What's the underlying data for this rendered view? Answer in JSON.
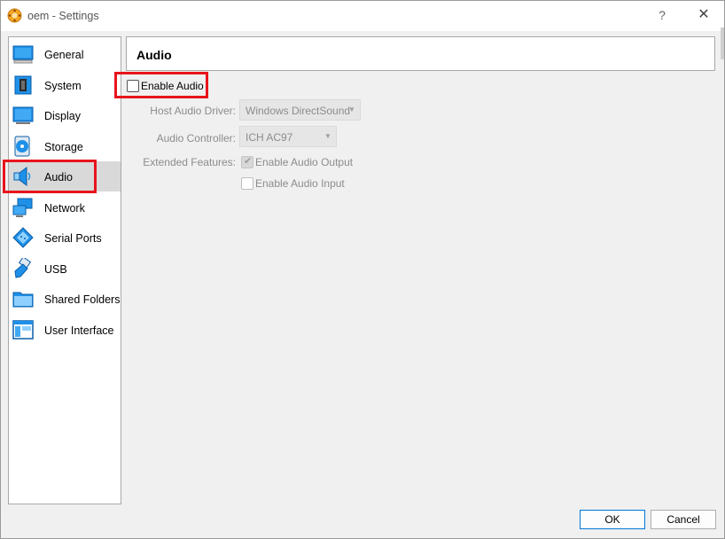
{
  "window": {
    "title": "oem - Settings",
    "help_glyph": "?",
    "close_glyph": "✕"
  },
  "sidebar": {
    "selected": "Audio",
    "items": [
      {
        "label": "General",
        "icon": "general-monitor-icon"
      },
      {
        "label": "System",
        "icon": "system-chip-icon"
      },
      {
        "label": "Display",
        "icon": "display-monitor-icon"
      },
      {
        "label": "Storage",
        "icon": "storage-disc-icon"
      },
      {
        "label": "Audio",
        "icon": "speaker-icon"
      },
      {
        "label": "Network",
        "icon": "network-icon"
      },
      {
        "label": "Serial Ports",
        "icon": "serial-port-icon"
      },
      {
        "label": "USB",
        "icon": "usb-icon"
      },
      {
        "label": "Shared Folders",
        "icon": "folder-icon"
      },
      {
        "label": "User Interface",
        "icon": "user-interface-icon"
      }
    ]
  },
  "audio": {
    "header": "Audio",
    "enable_audio": {
      "label": "Enable Audio",
      "checked": false
    },
    "host_driver": {
      "label": "Host Audio Driver:",
      "value": "Windows DirectSound"
    },
    "controller": {
      "label": "Audio Controller:",
      "value": "ICH AC97"
    },
    "extended_features": {
      "label": "Extended Features:",
      "enable_output": {
        "label": "Enable Audio Output",
        "checked": true
      },
      "enable_input": {
        "label": "Enable Audio Input",
        "checked": false
      }
    }
  },
  "buttons": {
    "ok": "OK",
    "cancel": "Cancel"
  },
  "colors": {
    "highlight": "#e8141c",
    "selected_bg": "#d9d9d9",
    "icon_blue": "#1e90e8",
    "default_button_border": "#0078d7"
  }
}
